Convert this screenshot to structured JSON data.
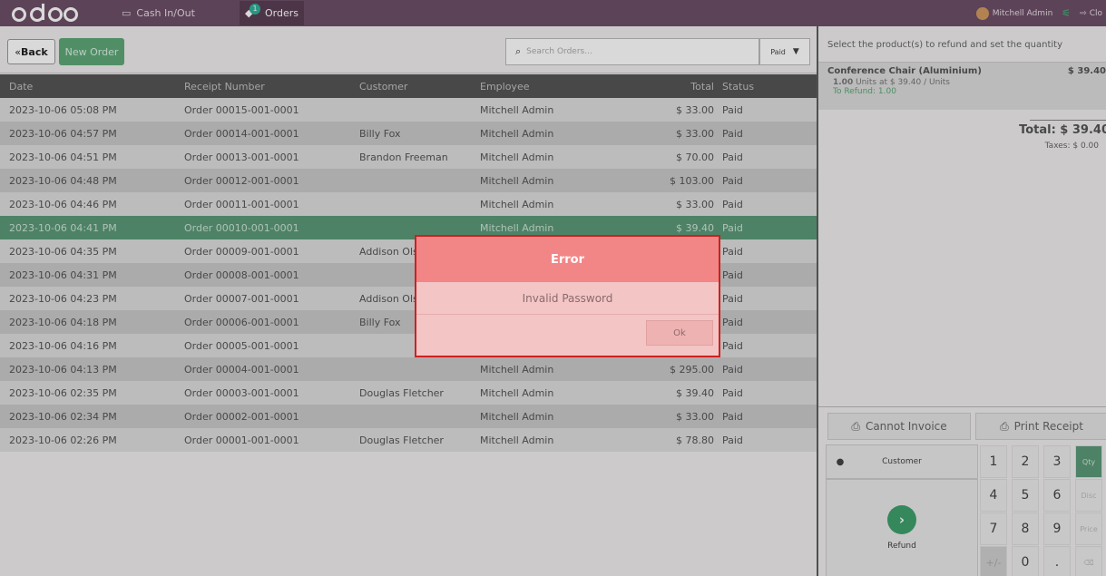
{
  "topbar": {
    "logo": "odoo",
    "cash_label": "Cash In/Out",
    "orders_label": "Orders",
    "orders_badge": "1",
    "user_name": "Mitchell Admin",
    "close_label": "Clo"
  },
  "control": {
    "back_label": "Back",
    "new_order_label": "New Order",
    "search_placeholder": "Search Orders...",
    "filter_value": "Paid"
  },
  "table": {
    "headers": [
      "Date",
      "Receipt Number",
      "Customer",
      "Employee",
      "Total",
      "Status"
    ],
    "rows": [
      {
        "date": "2023-10-06 05:08 PM",
        "receipt": "Order 00015-001-0001",
        "customer": "",
        "employee": "Mitchell Admin",
        "total": "$ 33.00",
        "status": "Paid"
      },
      {
        "date": "2023-10-06 04:57 PM",
        "receipt": "Order 00014-001-0001",
        "customer": "Billy Fox",
        "employee": "Mitchell Admin",
        "total": "$ 33.00",
        "status": "Paid"
      },
      {
        "date": "2023-10-06 04:51 PM",
        "receipt": "Order 00013-001-0001",
        "customer": "Brandon Freeman",
        "employee": "Mitchell Admin",
        "total": "$ 70.00",
        "status": "Paid"
      },
      {
        "date": "2023-10-06 04:48 PM",
        "receipt": "Order 00012-001-0001",
        "customer": "",
        "employee": "Mitchell Admin",
        "total": "$ 103.00",
        "status": "Paid"
      },
      {
        "date": "2023-10-06 04:46 PM",
        "receipt": "Order 00011-001-0001",
        "customer": "",
        "employee": "Mitchell Admin",
        "total": "$ 33.00",
        "status": "Paid"
      },
      {
        "date": "2023-10-06 04:41 PM",
        "receipt": "Order 00010-001-0001",
        "customer": "",
        "employee": "Mitchell Admin",
        "total": "$ 39.40",
        "status": "Paid"
      },
      {
        "date": "2023-10-06 04:35 PM",
        "receipt": "Order 00009-001-0001",
        "customer": "Addison Olsc",
        "employee": "",
        "total": "",
        "status": "Paid"
      },
      {
        "date": "2023-10-06 04:31 PM",
        "receipt": "Order 00008-001-0001",
        "customer": "",
        "employee": "",
        "total": "",
        "status": "Paid"
      },
      {
        "date": "2023-10-06 04:23 PM",
        "receipt": "Order 00007-001-0001",
        "customer": "Addison Olsc",
        "employee": "",
        "total": "",
        "status": "Paid"
      },
      {
        "date": "2023-10-06 04:18 PM",
        "receipt": "Order 00006-001-0001",
        "customer": "Billy Fox",
        "employee": "",
        "total": "",
        "status": "Paid"
      },
      {
        "date": "2023-10-06 04:16 PM",
        "receipt": "Order 00005-001-0001",
        "customer": "",
        "employee": "",
        "total": "",
        "status": "Paid"
      },
      {
        "date": "2023-10-06 04:13 PM",
        "receipt": "Order 00004-001-0001",
        "customer": "",
        "employee": "Mitchell Admin",
        "total": "$ 295.00",
        "status": "Paid"
      },
      {
        "date": "2023-10-06 02:35 PM",
        "receipt": "Order 00003-001-0001",
        "customer": "Douglas Fletcher",
        "employee": "Mitchell Admin",
        "total": "$ 39.40",
        "status": "Paid"
      },
      {
        "date": "2023-10-06 02:34 PM",
        "receipt": "Order 00002-001-0001",
        "customer": "",
        "employee": "Mitchell Admin",
        "total": "$ 33.00",
        "status": "Paid"
      },
      {
        "date": "2023-10-06 02:26 PM",
        "receipt": "Order 00001-001-0001",
        "customer": "Douglas Fletcher",
        "employee": "Mitchell Admin",
        "total": "$ 78.80",
        "status": "Paid"
      }
    ],
    "selected_index": 5
  },
  "refund_panel": {
    "hint": "Select the product(s) to refund and set the quantity",
    "line_name": "Conference Chair (Aluminium)",
    "line_price": "$ 39.40",
    "line_qty_bold": "1.00",
    "line_qty_rest": "Units at $ 39.40 / Units",
    "line_to_refund": "To Refund: 1.00",
    "total": "Total: $ 39.40",
    "taxes": "Taxes: $ 0.00"
  },
  "pad": {
    "invoice_label": "Cannot Invoice",
    "print_label": "Print Receipt",
    "customer_label": "Customer",
    "refund_label": "Refund",
    "keys": [
      [
        "1",
        "2",
        "3",
        "Qty"
      ],
      [
        "4",
        "5",
        "6",
        "Disc"
      ],
      [
        "7",
        "8",
        "9",
        "Price"
      ],
      [
        "+/-",
        "0",
        ".",
        "⌫"
      ]
    ],
    "active_mode": "Qty"
  },
  "error_dialog": {
    "title": "Error",
    "message": "Invalid Password",
    "ok_label": "Ok"
  }
}
